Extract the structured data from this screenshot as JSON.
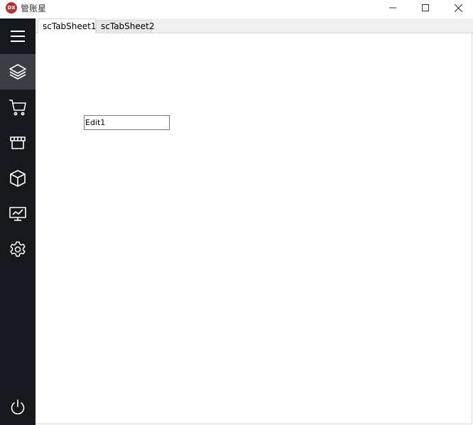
{
  "window": {
    "title": "管账星",
    "app_icon_text": "DX",
    "controls": [
      "minimize-icon",
      "maximize-icon",
      "close-icon"
    ]
  },
  "sidebar": {
    "background": "#15191d",
    "active_background": "#3a3f45",
    "items": [
      {
        "icon": "menu-icon",
        "active": false
      },
      {
        "icon": "layers-icon",
        "active": true
      },
      {
        "icon": "cart-icon",
        "active": false
      },
      {
        "icon": "store-icon",
        "active": false
      },
      {
        "icon": "box-icon",
        "active": false
      },
      {
        "icon": "chart-monitor-icon",
        "active": false
      },
      {
        "icon": "gear-icon",
        "active": false
      },
      {
        "icon": "power-icon",
        "active": false
      }
    ]
  },
  "tabs": [
    {
      "label": "scTabSheet1",
      "active": true
    },
    {
      "label": "scTabSheet2",
      "active": false
    }
  ],
  "content": {
    "edit1_value": "Edit1"
  }
}
